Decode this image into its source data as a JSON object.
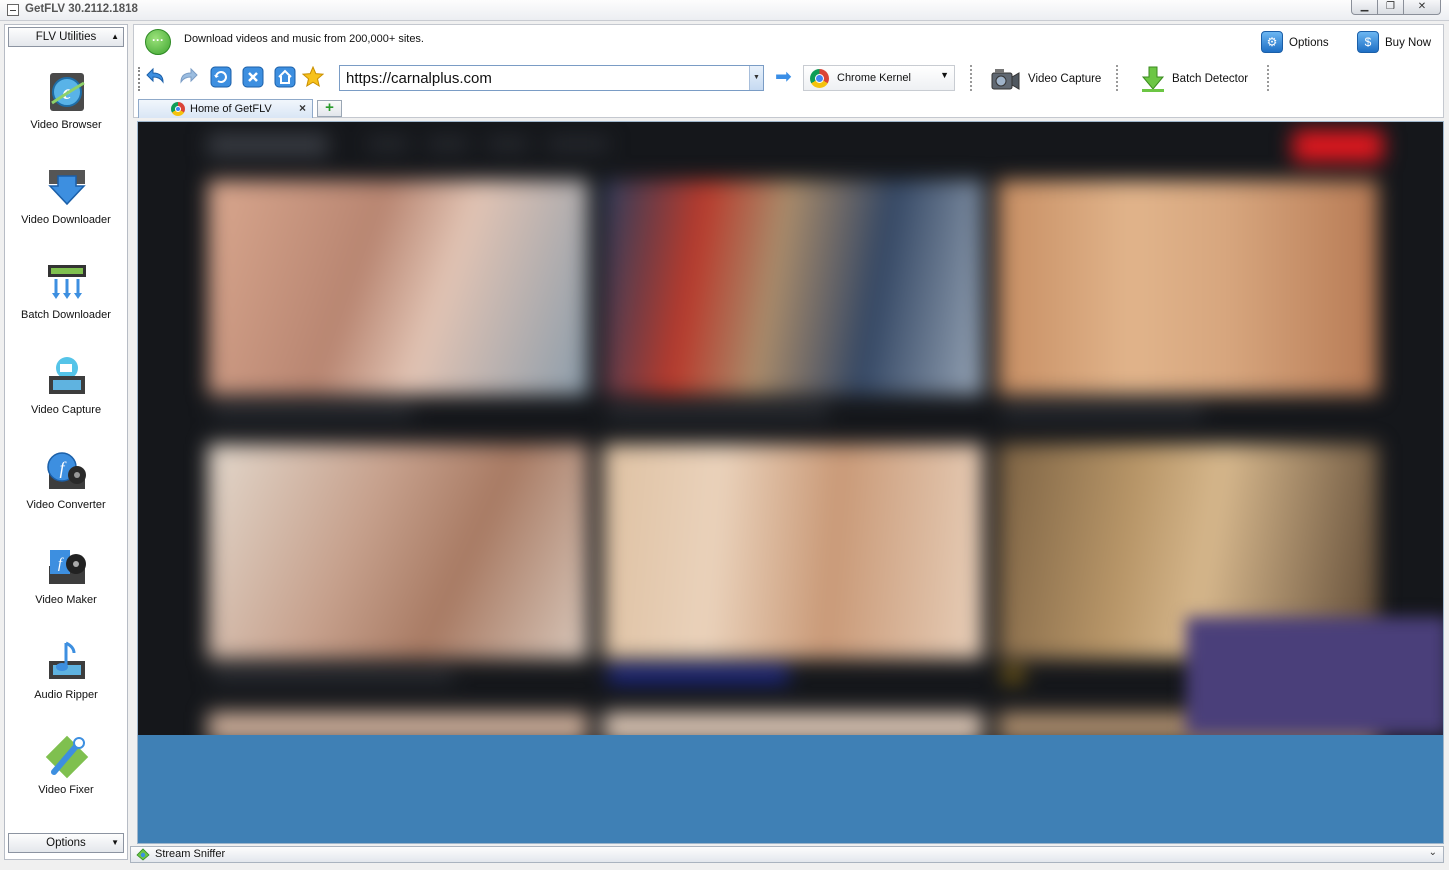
{
  "window": {
    "title": "GetFLV 30.2112.1818"
  },
  "left_panel": {
    "header": "FLV Utilities",
    "footer": "Options",
    "tools": [
      {
        "label": "Video Browser",
        "icon": "globe-film-icon"
      },
      {
        "label": "Video Downloader",
        "icon": "download-arrow-icon"
      },
      {
        "label": "Batch Downloader",
        "icon": "film-arrows-icon"
      },
      {
        "label": "Video Capture",
        "icon": "camera-film-icon"
      },
      {
        "label": "Video Converter",
        "icon": "convert-film-icon"
      },
      {
        "label": "Video Maker",
        "icon": "reel-film-icon"
      },
      {
        "label": "Audio Ripper",
        "icon": "note-film-icon"
      },
      {
        "label": "Video Fixer",
        "icon": "wrench-film-icon"
      }
    ]
  },
  "topbar": {
    "message": "Download videos and music from 200,000+ sites.",
    "options_label": "Options",
    "buynow_label": "Buy Now",
    "address": "https://carnalplus.com",
    "kernel": "Chrome Kernel",
    "video_capture_label": "Video Capture",
    "batch_detector_label": "Batch Detector"
  },
  "tabs": [
    {
      "label": "Home of GetFLV"
    }
  ],
  "statusbar": {
    "label": "Stream Sniffer"
  },
  "colors": {
    "viewport_bg": "#3f80b5",
    "accent": "#1f6fc4",
    "site_red": "#e0181f"
  }
}
